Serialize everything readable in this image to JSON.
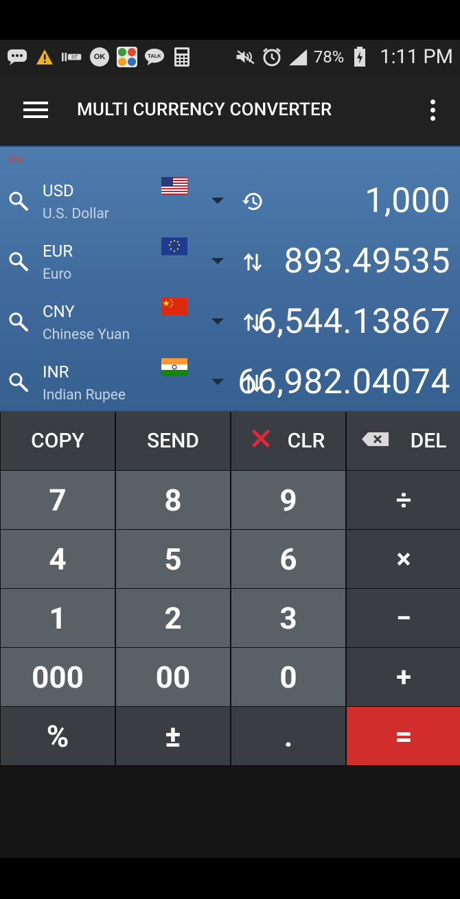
{
  "status_bar": {
    "left_icons": [
      "chat-bubble-icon",
      "warning-icon",
      "11st-icon",
      "okcashbag-icon",
      "currency-app-icon",
      "talk-icon",
      "calculator-icon"
    ],
    "battery": "78%",
    "time": "1:11 PM"
  },
  "app_bar": {
    "title": "MULTI CURRENCY CONVERTER"
  },
  "rates": {
    "lang": "EN",
    "rows": [
      {
        "code": "USD",
        "name": "U.S. Dollar",
        "amount": "1,000",
        "action_icon": "history-icon",
        "flag": "us"
      },
      {
        "code": "EUR",
        "name": "Euro",
        "amount": "893.49535",
        "action_icon": "swap-icon",
        "flag": "eu"
      },
      {
        "code": "CNY",
        "name": "Chinese Yuan",
        "amount": "6,544.13867",
        "action_icon": "swap-icon",
        "flag": "cn"
      },
      {
        "code": "INR",
        "name": "Indian Rupee",
        "amount": "66,982.04074",
        "action_icon": "swap-icon",
        "flag": "in"
      }
    ]
  },
  "keypad": {
    "copy": "COPY",
    "send": "SEND",
    "clr": "CLR",
    "del": "DEL",
    "k7": "7",
    "k8": "8",
    "k9": "9",
    "div": "÷",
    "k4": "4",
    "k5": "5",
    "k6": "6",
    "mul": "×",
    "k1": "1",
    "k2": "2",
    "k3": "3",
    "minus": "−",
    "k000": "000",
    "k00": "00",
    "k0": "0",
    "plus": "+",
    "pct": "%",
    "pm": "±",
    "dot": ".",
    "eq": "="
  },
  "colors": {
    "accent": "#d12d2d",
    "rates_bg": "#4a77a8",
    "key_num": "#5a6166",
    "key_dark": "#3a3d41"
  }
}
